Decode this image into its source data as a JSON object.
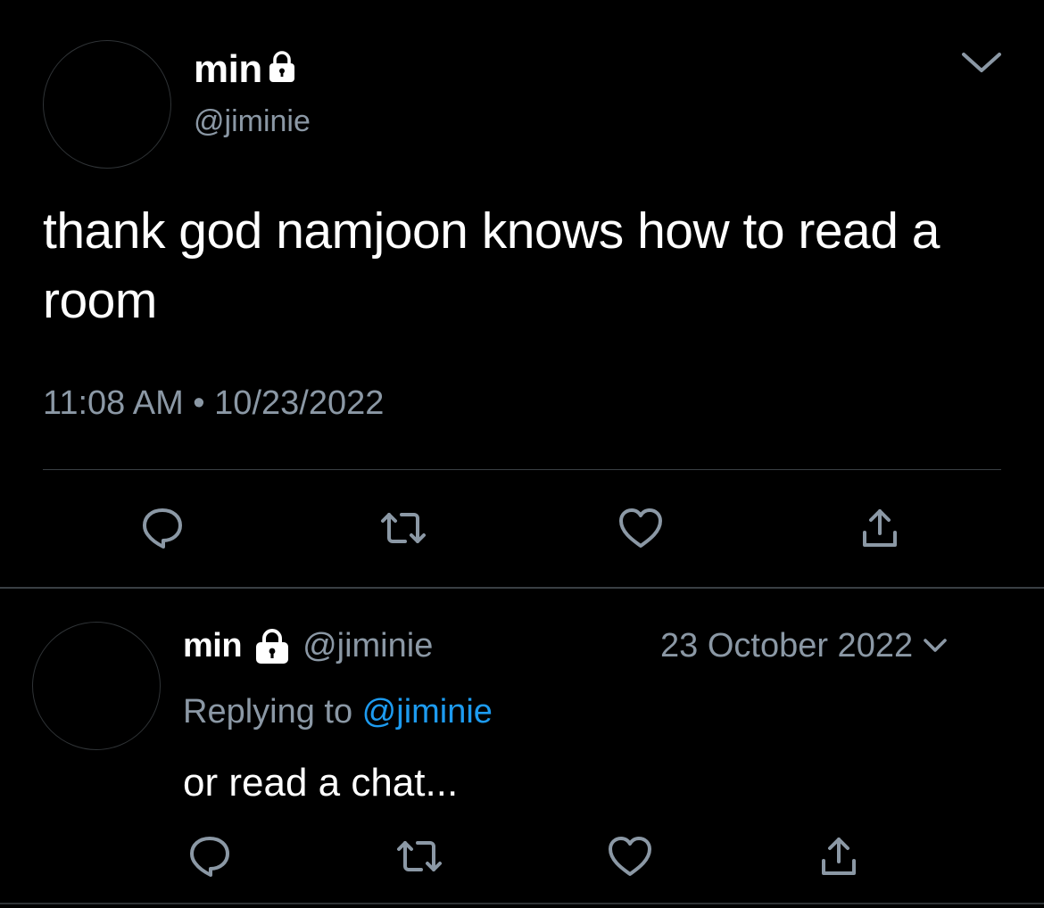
{
  "main_tweet": {
    "display_name": "min",
    "handle": "@jiminie",
    "text": "thank god namjoon knows how to read a room",
    "time": "11:08 AM",
    "separator": "•",
    "date": "10/23/2022",
    "protected_icon": "lock-icon",
    "menu_icon": "chevron-down-icon",
    "actions": [
      "reply-icon",
      "retweet-icon",
      "like-icon",
      "share-icon"
    ]
  },
  "reply_tweet": {
    "display_name": "min",
    "handle": "@jiminie",
    "date": "23 October 2022",
    "replying_prefix": "Replying to ",
    "replying_to": "@jiminie",
    "text": "or read a chat...",
    "protected_icon": "lock-icon",
    "menu_icon": "chevron-down-icon",
    "actions": [
      "reply-icon",
      "retweet-icon",
      "like-icon",
      "share-icon"
    ]
  },
  "colors": {
    "background": "#000000",
    "text_primary": "#ffffff",
    "text_secondary": "#8b98a5",
    "link": "#1d9bf0",
    "divider": "#3a3f44",
    "icon": "#8b98a5"
  }
}
